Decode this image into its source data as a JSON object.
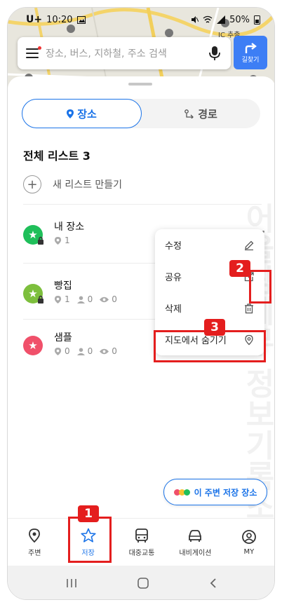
{
  "status_bar": {
    "carrier": "U+",
    "time": "10:20",
    "battery": "50%"
  },
  "search": {
    "placeholder": "장소, 버스, 지하철, 주소 검색"
  },
  "route_button": {
    "label": "길찾기"
  },
  "map_label": "JC 추출",
  "tabs": [
    {
      "label": "장소",
      "active": true
    },
    {
      "label": "경로",
      "active": false
    }
  ],
  "list_header": "전체 리스트 3",
  "new_list_label": "새 리스트 만들기",
  "lists": [
    {
      "name": "내 장소",
      "color": "#1fbf5a",
      "place_count": "1",
      "locked": true,
      "show_more": true
    },
    {
      "name": "빵집",
      "color": "#7dbf3d",
      "place_count": "1",
      "user_count": "0",
      "view_count": "0",
      "locked": true,
      "show_more": true
    },
    {
      "name": "샘플",
      "color": "#f0506a",
      "place_count": "0",
      "user_count": "0",
      "view_count": "0",
      "locked": false,
      "show_more": false
    }
  ],
  "context_menu": [
    {
      "label": "수정",
      "icon": "pencil-icon"
    },
    {
      "label": "공유",
      "icon": "share-icon"
    },
    {
      "label": "삭제",
      "icon": "trash-icon"
    },
    {
      "label": "지도에서 숨기기",
      "icon": "map-pin-icon"
    }
  ],
  "nearby_button": "이 주변 저장 장소",
  "bottom_nav": [
    {
      "label": "주변",
      "icon": "location-icon",
      "active": false
    },
    {
      "label": "저장",
      "icon": "star-icon",
      "active": true
    },
    {
      "label": "대중교통",
      "icon": "bus-icon",
      "active": false
    },
    {
      "label": "내비게이션",
      "icon": "car-icon",
      "active": false
    },
    {
      "label": "MY",
      "icon": "person-icon",
      "active": false
    }
  ],
  "annotations": [
    "1",
    "2",
    "3"
  ],
  "watermark": "어울림세무 정보기록소실",
  "colors": {
    "accent": "#1a73e8",
    "annotation": "#e41e1e"
  }
}
